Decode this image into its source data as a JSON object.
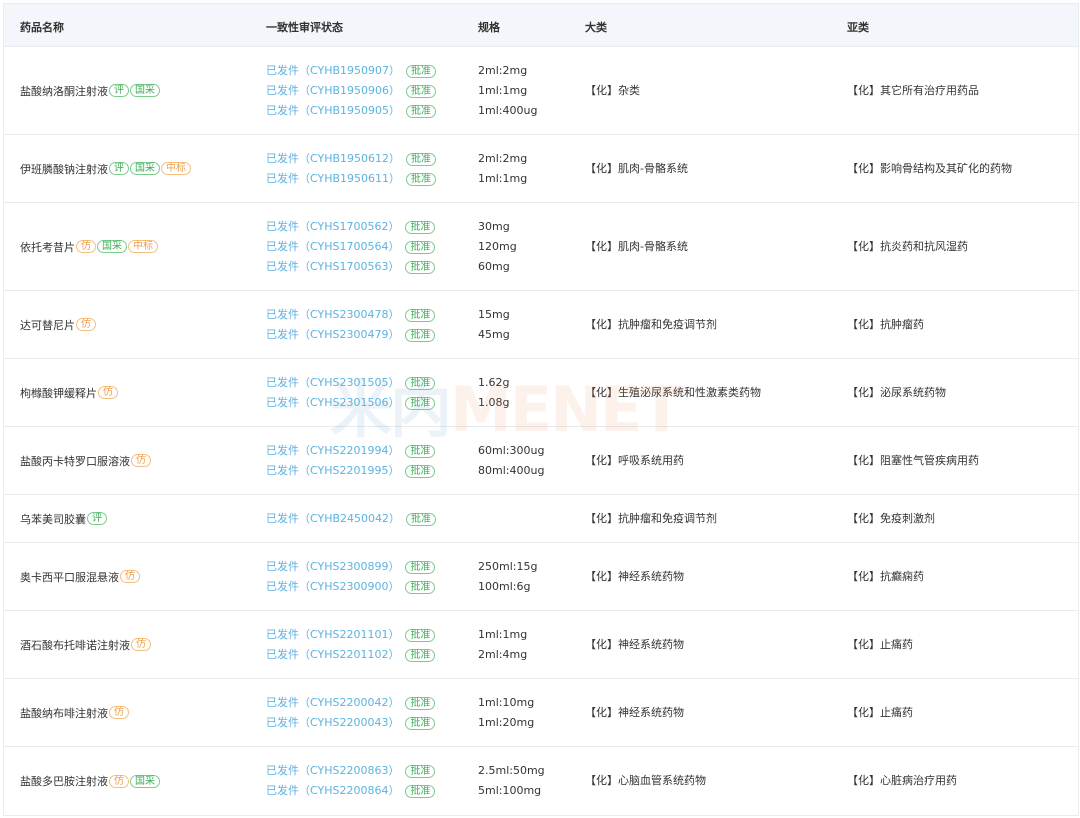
{
  "headers": [
    "药品名称",
    "一致性审评状态",
    "规格",
    "大类",
    "亚类"
  ],
  "approved_tag": "批准",
  "watermark": {
    "part1": "米内",
    "part2": "MENET"
  },
  "rows": [
    {
      "name": "盐酸纳洛酮注射液",
      "tags": [
        {
          "text": "评",
          "color": "green"
        },
        {
          "text": "国采",
          "color": "green"
        }
      ],
      "reviews": [
        "已发件（CYHB1950907）",
        "已发件（CYHB1950906）",
        "已发件（CYHB1950905）"
      ],
      "specs": [
        "2ml:2mg",
        "1ml:1mg",
        "1ml:400ug"
      ],
      "category": "【化】杂类",
      "subcategory": "【化】其它所有治疗用药品"
    },
    {
      "name": "伊班膦酸钠注射液",
      "tags": [
        {
          "text": "评",
          "color": "green"
        },
        {
          "text": "国采",
          "color": "green"
        },
        {
          "text": "中标",
          "color": "orange"
        }
      ],
      "reviews": [
        "已发件（CYHB1950612）",
        "已发件（CYHB1950611）"
      ],
      "specs": [
        "2ml:2mg",
        "1ml:1mg"
      ],
      "category": "【化】肌肉-骨骼系统",
      "subcategory": "【化】影响骨结构及其矿化的药物"
    },
    {
      "name": "依托考昔片",
      "tags": [
        {
          "text": "仿",
          "color": "orange"
        },
        {
          "text": "国采",
          "color": "green"
        },
        {
          "text": "中标",
          "color": "orange"
        }
      ],
      "reviews": [
        "已发件（CYHS1700562）",
        "已发件（CYHS1700564）",
        "已发件（CYHS1700563）"
      ],
      "specs": [
        "30mg",
        "120mg",
        "60mg"
      ],
      "category": "【化】肌肉-骨骼系统",
      "subcategory": "【化】抗炎药和抗风湿药"
    },
    {
      "name": "达可替尼片",
      "tags": [
        {
          "text": "仿",
          "color": "orange"
        }
      ],
      "reviews": [
        "已发件（CYHS2300478）",
        "已发件（CYHS2300479）"
      ],
      "specs": [
        "15mg",
        "45mg"
      ],
      "category": "【化】抗肿瘤和免疫调节剂",
      "subcategory": "【化】抗肿瘤药"
    },
    {
      "name": "枸橼酸钾缓释片",
      "tags": [
        {
          "text": "仿",
          "color": "orange"
        }
      ],
      "reviews": [
        "已发件（CYHS2301505）",
        "已发件（CYHS2301506）"
      ],
      "specs": [
        "1.62g",
        "1.08g"
      ],
      "category": "【化】生殖泌尿系统和性激素类药物",
      "subcategory": "【化】泌尿系统药物"
    },
    {
      "name": "盐酸丙卡特罗口服溶液",
      "tags": [
        {
          "text": "仿",
          "color": "orange"
        }
      ],
      "reviews": [
        "已发件（CYHS2201994）",
        "已发件（CYHS2201995）"
      ],
      "specs": [
        "60ml:300ug",
        "80ml:400ug"
      ],
      "category": "【化】呼吸系统用药",
      "subcategory": "【化】阻塞性气管疾病用药"
    },
    {
      "name": "乌苯美司胶囊",
      "tags": [
        {
          "text": "评",
          "color": "green"
        }
      ],
      "reviews": [
        "已发件（CYHB2450042）"
      ],
      "specs": [],
      "category": "【化】抗肿瘤和免疫调节剂",
      "subcategory": "【化】免疫刺激剂"
    },
    {
      "name": "奥卡西平口服混悬液",
      "tags": [
        {
          "text": "仿",
          "color": "orange"
        }
      ],
      "reviews": [
        "已发件（CYHS2300899）",
        "已发件（CYHS2300900）"
      ],
      "specs": [
        "250ml:15g",
        "100ml:6g"
      ],
      "category": "【化】神经系统药物",
      "subcategory": "【化】抗癫痫药"
    },
    {
      "name": "酒石酸布托啡诺注射液",
      "tags": [
        {
          "text": "仿",
          "color": "orange"
        }
      ],
      "reviews": [
        "已发件（CYHS2201101）",
        "已发件（CYHS2201102）"
      ],
      "specs": [
        "1ml:1mg",
        "2ml:4mg"
      ],
      "category": "【化】神经系统药物",
      "subcategory": "【化】止痛药"
    },
    {
      "name": "盐酸纳布啡注射液",
      "tags": [
        {
          "text": "仿",
          "color": "orange"
        }
      ],
      "reviews": [
        "已发件（CYHS2200042）",
        "已发件（CYHS2200043）"
      ],
      "specs": [
        "1ml:10mg",
        "1ml:20mg"
      ],
      "category": "【化】神经系统药物",
      "subcategory": "【化】止痛药"
    },
    {
      "name": "盐酸多巴胺注射液",
      "tags": [
        {
          "text": "仿",
          "color": "orange"
        },
        {
          "text": "国采",
          "color": "green"
        }
      ],
      "reviews": [
        "已发件（CYHS2200863）",
        "已发件（CYHS2200864）"
      ],
      "specs": [
        "2.5ml:50mg",
        "5ml:100mg"
      ],
      "category": "【化】心脑血管系统药物",
      "subcategory": "【化】心脏病治疗用药"
    }
  ]
}
